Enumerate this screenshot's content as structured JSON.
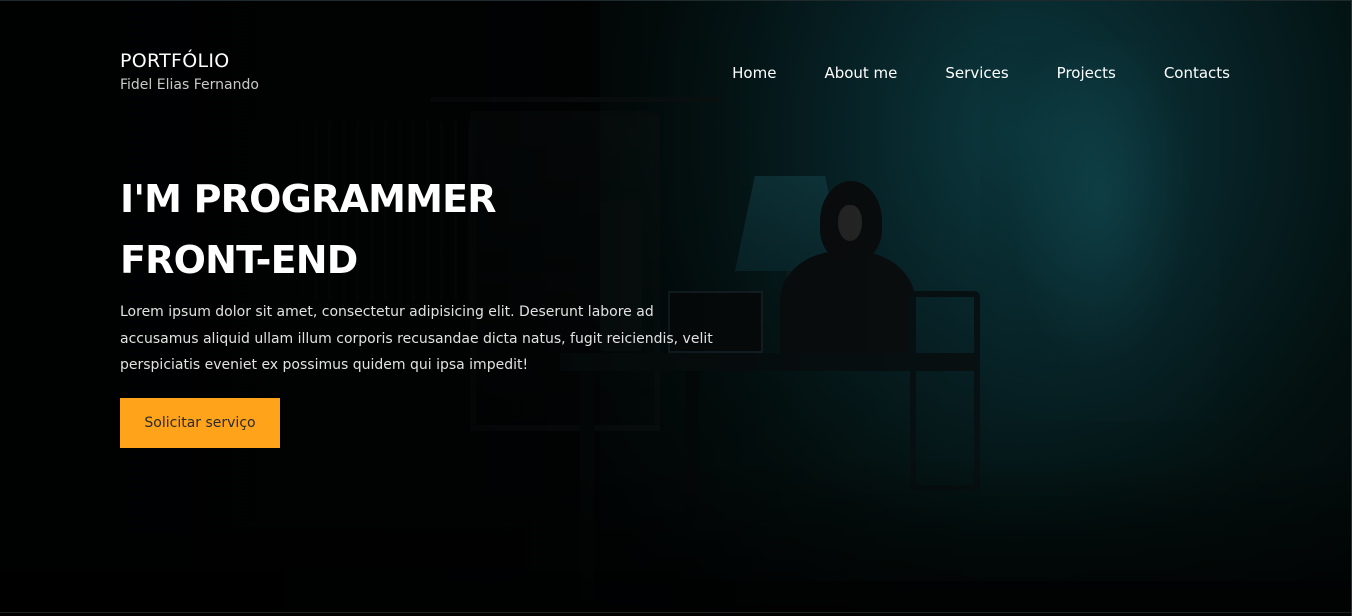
{
  "brand": {
    "title": "PORTFÓLIO",
    "subtitle": "Fidel Elias Fernando"
  },
  "nav": {
    "items": [
      {
        "label": "Home"
      },
      {
        "label": "About me"
      },
      {
        "label": "Services"
      },
      {
        "label": "Projects"
      },
      {
        "label": "Contacts"
      }
    ]
  },
  "hero": {
    "headline_line1": "I'M PROGRAMMER",
    "headline_line2": "FRONT-END",
    "description": "Lorem ipsum dolor sit amet, consectetur adipisicing elit. Deserunt labore ad accusamus aliquid ullam illum corporis recusandae dicta natus, fugit reiciendis, velit perspiciatis eveniet ex possimus quidem qui ipsa impedit!",
    "cta_label": "Solicitar serviço",
    "background_image": "person-in-hoodie-at-desk-dark-room"
  },
  "colors": {
    "accent": "#ffa31a",
    "background": "#020506",
    "glow": "#0b3a40"
  }
}
